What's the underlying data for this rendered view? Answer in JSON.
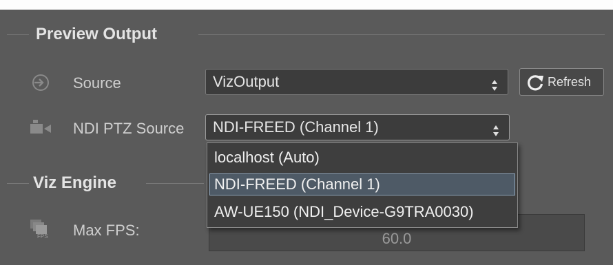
{
  "sections": {
    "preview_output": {
      "title": "Preview Output"
    },
    "viz_engine": {
      "title": "Viz Engine"
    }
  },
  "source": {
    "label": "Source",
    "icon": "input-arrow-icon",
    "value": "VizOutput",
    "refresh_label": "Refresh"
  },
  "ndi_ptz": {
    "label": "NDI PTZ Source",
    "icon": "video-camera-icon",
    "value": "NDI-FREED (Channel 1)",
    "options": [
      "localhost (Auto)",
      "NDI-FREED (Channel 1)",
      "AW-UE150 (NDI_Device-G9TRA0030)"
    ]
  },
  "max_fps": {
    "label": "Max FPS:",
    "icon": "fps-icon",
    "icon_text": "FPS",
    "value": "60.0"
  },
  "colors": {
    "background": "#5a5a5a",
    "field": "#3c3c3c",
    "selected_option": "#4e5a66"
  }
}
